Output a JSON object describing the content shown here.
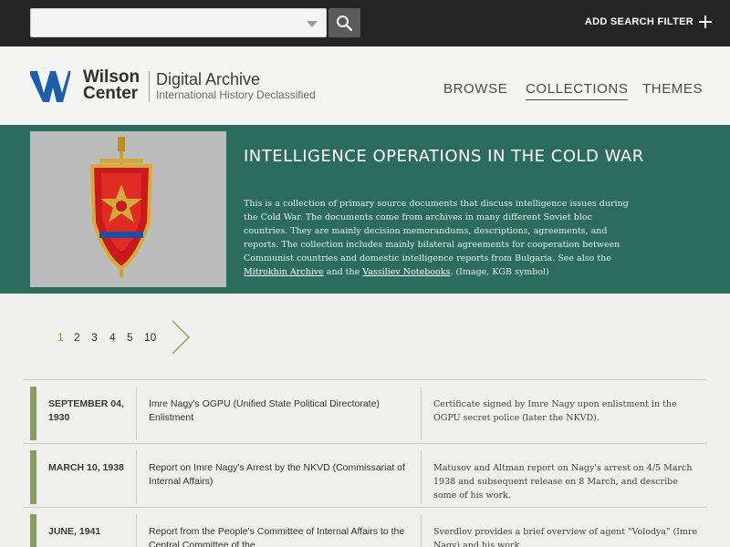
{
  "topbar": {
    "search_value": "",
    "add_filter_label": "ADD SEARCH FILTER"
  },
  "header": {
    "brand_line1": "Wilson",
    "brand_line2": "Center",
    "title": "Digital Archive",
    "subtitle": "International History Declassified",
    "nav": [
      "BROWSE",
      "COLLECTIONS",
      "THEMES"
    ],
    "active_nav": "COLLECTIONS"
  },
  "collection": {
    "title": "INTELLIGENCE OPERATIONS IN THE COLD WAR",
    "description_part1": "This is a collection of primary source documents that discuss intelligence issues during the Cold War. The documents come from archives in many different Soviet bloc countries. They are mainly decision memorandums, descriptions, agreements, and reports. The collection includes mainly bilateral agreements for cooperation between Communist countries and domestic intelligence reports from Bulgaria. See also the ",
    "link1": "Mitrokhin Archive",
    "description_part2": " and the ",
    "link2": "Vassiliev Notebooks",
    "description_part3": ". (Image, KGB symbol)"
  },
  "pagination": {
    "pages": [
      "1",
      "2",
      "3",
      "4",
      "5",
      "10"
    ],
    "current": "1"
  },
  "documents": [
    {
      "date": "SEPTEMBER 04, 1930",
      "title": "Imre Nagy's OGPU (Unified State Political Directorate) Enlistment",
      "description": "Certificate signed by Imre Nagy upon enlistment in the OGPU secret police (later the NKVD)."
    },
    {
      "date": "MARCH 10, 1938",
      "title": "Report on Imre Nagy's Arrest by the NKVD (Commissariat of Internal Affairs)",
      "description": "Matusov and Altman report on Nagy's arrest on 4/5 March 1938 and subsequent release on 8 March, and describe some of his work."
    },
    {
      "date": "JUNE, 1941",
      "title": "Report from the People's Committee of Internal Affairs to the Central Committee of the",
      "description": "Sverdlov provides a brief overview of agent \"Volodya\" (Imre Nagy) and his work."
    }
  ],
  "colors": {
    "hero_bg": "#2c6c5d",
    "row_accent": "#8c9c5b",
    "topbar_bg": "#252525",
    "logo_blue": "#1d5fa8"
  }
}
